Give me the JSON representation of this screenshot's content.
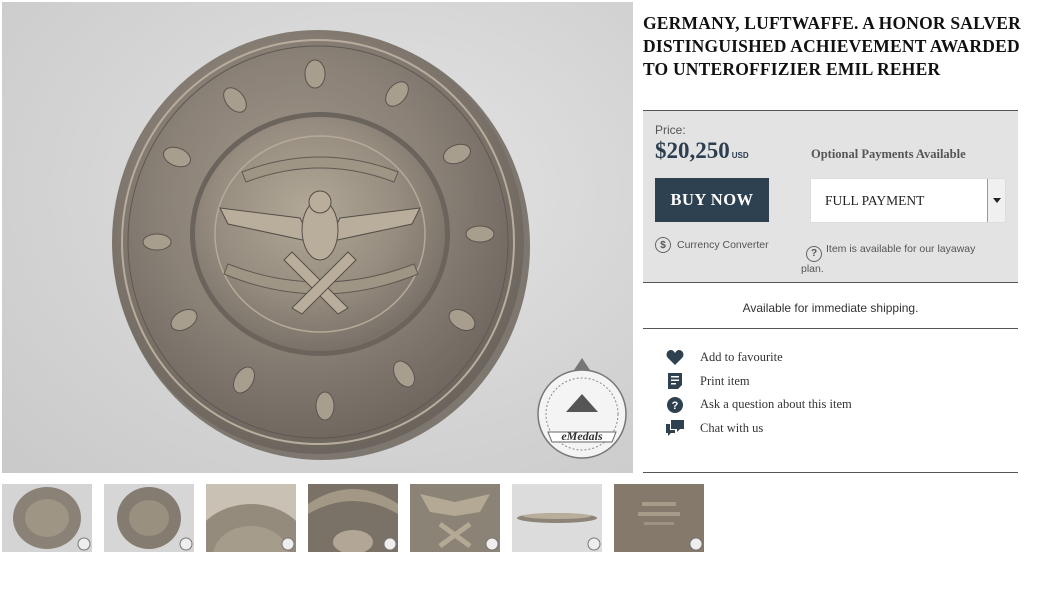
{
  "product": {
    "title": "GERMANY, LUFTWAFFE. A HONOR SALVER DISTINGUISHED ACHIEVEMENT AWARDED TO UNTEROFFIZIER EMIL REHER",
    "images": {
      "main_alt": "Luftwaffe honor salver",
      "watermark": "eMedals",
      "watermark_ring": "Purveyors of Authentic Militaria",
      "thumbnail_count": 7
    }
  },
  "pricing": {
    "price_label": "Price:",
    "price": "$20,250",
    "currency": "USD",
    "optional_payments_label": "Optional Payments Available",
    "buy_button": "BUY NOW",
    "payment_select": {
      "selected": "FULL PAYMENT"
    },
    "currency_converter": "Currency Converter",
    "layaway_note": "Item is available for our layaway plan."
  },
  "shipping": {
    "status": "Available for immediate shipping."
  },
  "actions": [
    {
      "label": "Add to favourite",
      "icon": "heart-icon"
    },
    {
      "label": "Print item",
      "icon": "document-icon"
    },
    {
      "label": "Ask a question about this item",
      "icon": "question-icon"
    },
    {
      "label": "Chat with us",
      "icon": "chat-icon"
    }
  ],
  "colors": {
    "accent": "#2e4150",
    "price_box_bg": "#e3e3e3",
    "price_text": "#2c3e50"
  }
}
